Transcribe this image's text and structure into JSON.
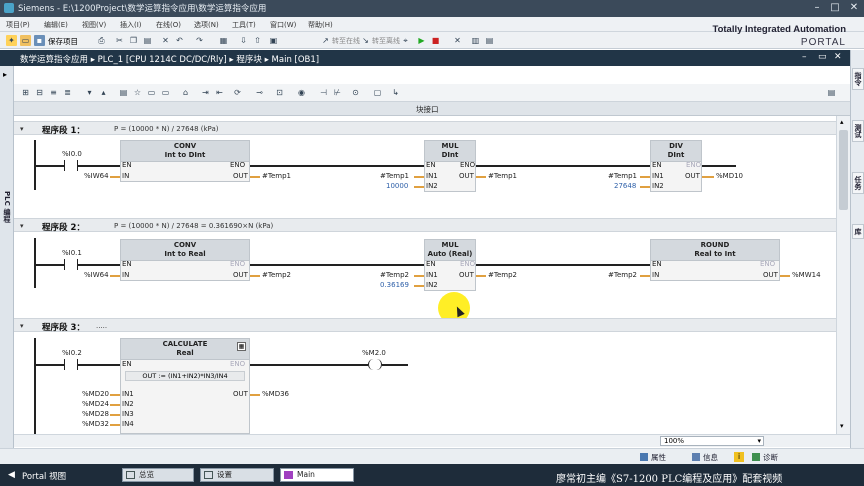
{
  "window": {
    "title": "Siemens  -  E:\\1200Project\\数学运算指令应用\\数学运算指令应用"
  },
  "menu": [
    "项目(P)",
    "编辑(E)",
    "视图(V)",
    "插入(I)",
    "在线(O)",
    "选项(N)",
    "工具(T)",
    "窗口(W)",
    "帮助(H)"
  ],
  "toolbar": {
    "save_label": "保存项目",
    "online_label": "转至在线",
    "offline_label": "转至离线"
  },
  "brand": {
    "line1": "Totally Integrated Automation",
    "line2": "PORTAL"
  },
  "breadcrumb": "数学运算指令应用 ▸ PLC_1 [CPU 1214C DC/DC/Rly] ▸ 程序块 ▸ Main [OB1]",
  "left_panel": {
    "label": "PLC 编程"
  },
  "right_tabs": [
    "指令",
    "测试",
    "任务",
    "库"
  ],
  "interface_bar": {
    "label": "块接口"
  },
  "networks": [
    {
      "title": "程序段 1：",
      "comment": "P = (10000 * N) / 27648 (kPa)"
    },
    {
      "title": "程序段 2：",
      "comment": "P = (10000 * N) / 27648 = 0.361690×N (kPa)"
    },
    {
      "title": "程序段 3：",
      "comment": "....."
    }
  ],
  "nw1": {
    "contact": "%I0.0",
    "conv": {
      "name": "CONV",
      "type": "Int to DInt",
      "in": "%IW64",
      "out": "#Temp1"
    },
    "mul": {
      "name": "MUL",
      "type": "DInt",
      "in1": "#Temp1",
      "in2": "10000",
      "out": "#Temp1"
    },
    "div": {
      "name": "DIV",
      "type": "DInt",
      "in1": "#Temp1",
      "in2": "27648",
      "out": "%MD10"
    }
  },
  "nw2": {
    "contact": "%I0.1",
    "conv": {
      "name": "CONV",
      "type": "Int to Real",
      "in": "%IW64",
      "out": "#Temp2"
    },
    "mul": {
      "name": "MUL",
      "type": "Auto (Real)",
      "in1": "#Temp2",
      "in2": "0.36169",
      "out": "#Temp2"
    },
    "round": {
      "name": "ROUND",
      "type": "Real to Int",
      "in": "#Temp2",
      "out": "%MW14"
    }
  },
  "nw3": {
    "contact": "%I0.2",
    "calc": {
      "name": "CALCULATE",
      "type": "Real",
      "formula": "OUT := (IN1+IN2)*IN3/IN4",
      "out": "%MD36"
    },
    "inputs": [
      "%MD20",
      "%MD24",
      "%MD28",
      "%MD32"
    ],
    "coil": "%M2.0"
  },
  "pins": {
    "en": "EN",
    "eno": "ENO",
    "in": "IN",
    "out": "OUT",
    "in1": "IN1",
    "in2": "IN2",
    "in3": "IN3",
    "in4": "IN4"
  },
  "zoom": "100%",
  "status": {
    "properties": "属性",
    "info": "信息",
    "diagnostics": "诊断"
  },
  "taskbar": {
    "portal": "Portal 视图",
    "tabs": [
      "总览",
      "设置",
      "Main"
    ]
  },
  "watermark": "廖常初主编《S7-1200 PLC编程及应用》配套视频",
  "colors": {
    "titlebar": "#3b4a5a",
    "breadcrumb": "#213547",
    "taskbar": "#1e2c3a",
    "wire_active": "#e0a040",
    "param_blue": "#2d5fa8"
  }
}
